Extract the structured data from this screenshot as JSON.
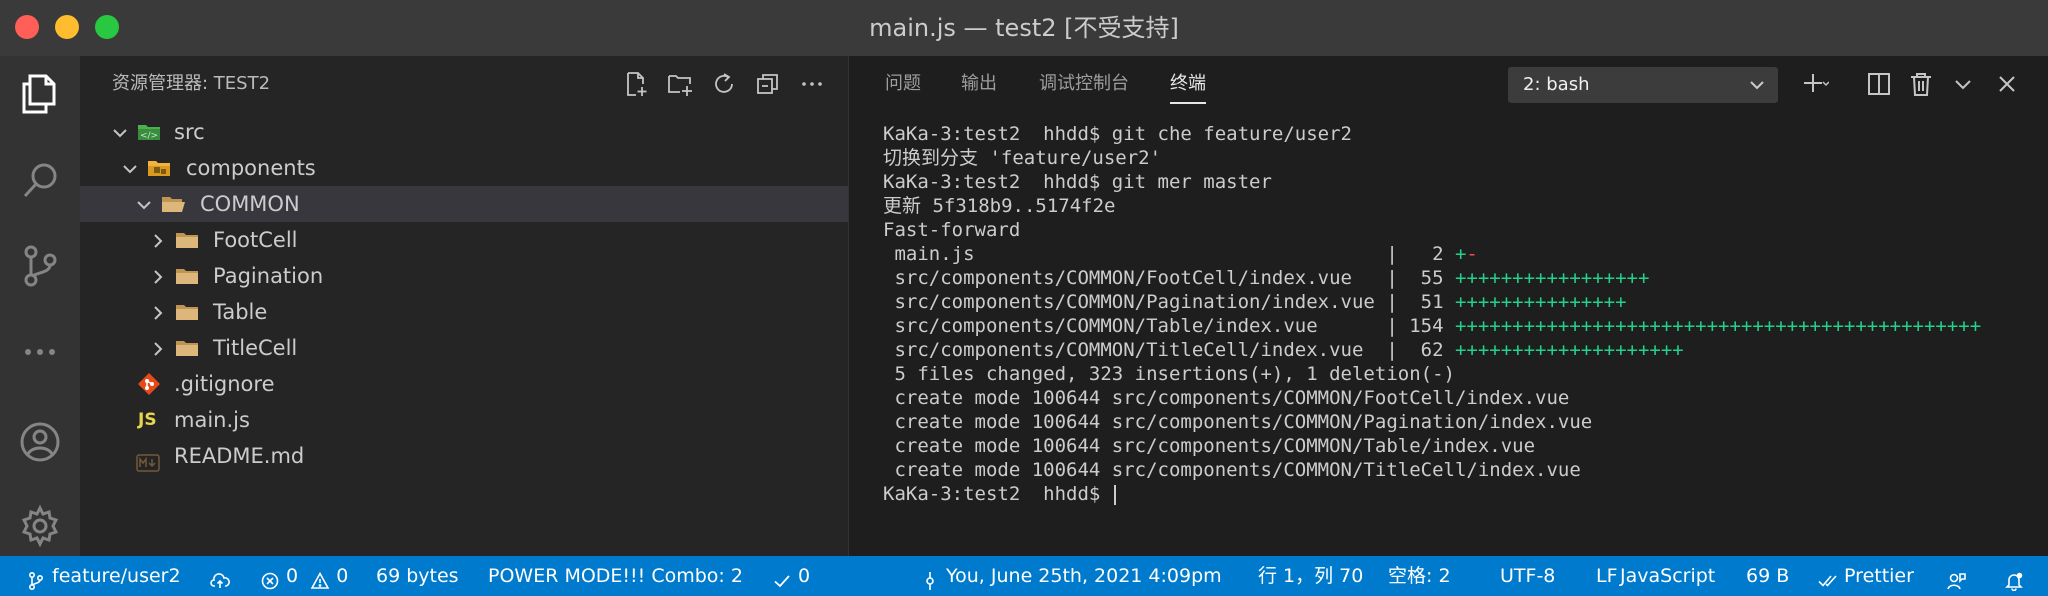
{
  "window": {
    "title": "main.js — test2 [不受支持]"
  },
  "sidebar": {
    "title": "资源管理器: TEST2",
    "tree": [
      {
        "label": "src",
        "type": "folder",
        "expanded": true
      },
      {
        "label": "components",
        "type": "folder",
        "expanded": true
      },
      {
        "label": "COMMON",
        "type": "folder",
        "expanded": true,
        "selected": true
      },
      {
        "label": "FootCell",
        "type": "folder",
        "expanded": false
      },
      {
        "label": "Pagination",
        "type": "folder",
        "expanded": false
      },
      {
        "label": "Table",
        "type": "folder",
        "expanded": false
      },
      {
        "label": "TitleCell",
        "type": "folder",
        "expanded": false
      },
      {
        "label": ".gitignore",
        "type": "file",
        "icon": "git-file-icon"
      },
      {
        "label": "main.js",
        "type": "file",
        "icon_text": "JS"
      },
      {
        "label": "README.md",
        "type": "file",
        "icon": "markdown-icon"
      }
    ]
  },
  "panel": {
    "tabs": [
      {
        "label": "问题"
      },
      {
        "label": "输出"
      },
      {
        "label": "调试控制台"
      },
      {
        "label": "终端",
        "active": true
      }
    ],
    "terminal_select": "2: bash"
  },
  "terminal": {
    "lines": [
      {
        "text": "KaKa-3:test2  hhdd$ git che feature/user2"
      },
      {
        "text": "切换到分支 'feature/user2'"
      },
      {
        "text": "KaKa-3:test2  hhdd$ git mer master"
      },
      {
        "text": "更新 5f318b9..5174f2e"
      },
      {
        "text": "Fast-forward"
      },
      {
        "text": " main.js                                    |   2 ",
        "plus": "+",
        "minus": "-"
      },
      {
        "text": " src/components/COMMON/FootCell/index.vue   |  55 ",
        "plus": "+++++++++++++++++",
        "minus": ""
      },
      {
        "text": " src/components/COMMON/Pagination/index.vue |  51 ",
        "plus": "+++++++++++++++",
        "minus": ""
      },
      {
        "text": " src/components/COMMON/Table/index.vue      | 154 ",
        "plus": "++++++++++++++++++++++++++++++++++++++++++++++",
        "minus": ""
      },
      {
        "text": " src/components/COMMON/TitleCell/index.vue  |  62 ",
        "plus": "++++++++++++++++++++",
        "minus": ""
      },
      {
        "text": " 5 files changed, 323 insertions(+), 1 deletion(-)"
      },
      {
        "text": " create mode 100644 src/components/COMMON/FootCell/index.vue"
      },
      {
        "text": " create mode 100644 src/components/COMMON/Pagination/index.vue"
      },
      {
        "text": " create mode 100644 src/components/COMMON/Table/index.vue"
      },
      {
        "text": " create mode 100644 src/components/COMMON/TitleCell/index.vue"
      },
      {
        "text": "KaKa-3:test2  hhdd$ "
      }
    ]
  },
  "statusbar": {
    "branch": "feature/user2",
    "errors": "0",
    "warnings": "0",
    "size": "69 bytes",
    "power_mode": "POWER MODE!!! Combo: 2",
    "checks": "0",
    "blame": "You, June 25th, 2021 4:09pm",
    "position": "行 1，列 70",
    "spaces": "空格: 2",
    "encoding": "UTF-8",
    "eol": "LF",
    "language": "JavaScript",
    "file_size": "69 B",
    "formatter": "Prettier"
  },
  "colors": {
    "statusbar": "#007acc",
    "diff_plus": "#23d18b",
    "diff_minus": "#f14c4c"
  }
}
